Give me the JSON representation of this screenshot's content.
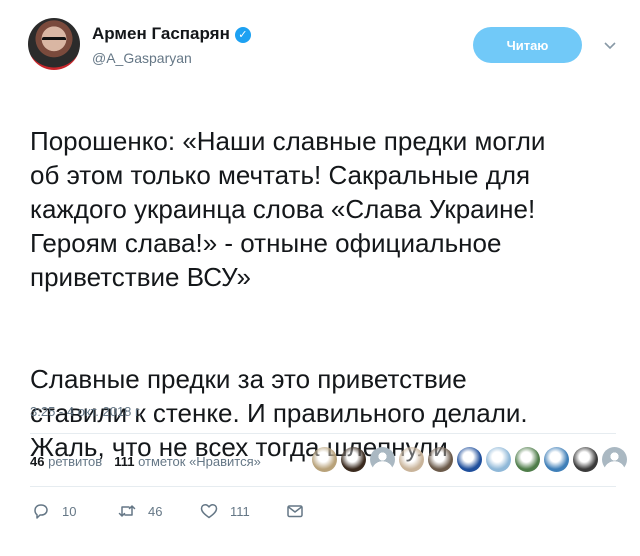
{
  "author": {
    "name": "Армен Гаспарян",
    "handle": "@A_Gasparyan",
    "verified_badge": "✓"
  },
  "follow_button": {
    "label": "Читаю",
    "color": "#71c9f8"
  },
  "menu": {
    "icon": "chevron-down-icon"
  },
  "tweet": {
    "paragraph1": "Порошенко: «Наши славные предки могли\nоб этом только мечтать! Сакральные для\nкаждого украинца слова «Слава Украине!\nГероям слава!» - отныне официальное\nприветствие ВСУ»",
    "paragraph2": "Славные предки за это приветствие\nставили к стенке. И правильного делали.\nЖаль, что не всех тогда шлепнули",
    "timestamp": "3:25 - 4 окт. 2018 г."
  },
  "stats": {
    "retweets_count": "46",
    "retweets_label": "ретвитов",
    "likes_count": "111",
    "likes_label": "отметок «Нравится»"
  },
  "likers": [
    {
      "icon": "avatar",
      "color": "#b8a27a"
    },
    {
      "icon": "avatar",
      "color": "#3a2a1e"
    },
    {
      "icon": "avatar-placeholder",
      "color": "#aab8c2"
    },
    {
      "icon": "avatar",
      "color": "#c9b49a"
    },
    {
      "icon": "avatar",
      "color": "#6b5a4a"
    },
    {
      "icon": "avatar",
      "color": "#1f4f9c"
    },
    {
      "icon": "avatar",
      "color": "#8fb8d8"
    },
    {
      "icon": "avatar",
      "color": "#4f7d4a"
    },
    {
      "icon": "avatar",
      "color": "#3f7fb8"
    },
    {
      "icon": "avatar",
      "color": "#3b3b3b"
    },
    {
      "icon": "avatar-placeholder",
      "color": "#aab8c2"
    }
  ],
  "actions": {
    "reply": {
      "icon": "reply-icon",
      "count": "10"
    },
    "retweet": {
      "icon": "retweet-icon",
      "count": "46"
    },
    "like": {
      "icon": "heart-icon",
      "count": "111"
    },
    "dm": {
      "icon": "envelope-icon"
    }
  }
}
